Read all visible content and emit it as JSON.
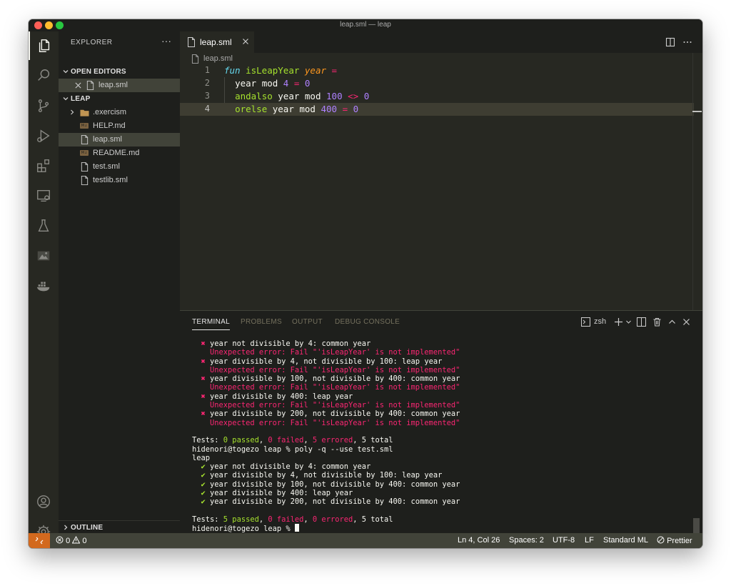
{
  "window": {
    "title": "leap.sml — leap"
  },
  "sidebar": {
    "title": "EXPLORER",
    "more": "···",
    "open_editors": {
      "label": "OPEN EDITORS",
      "items": [
        {
          "name": "leap.sml"
        }
      ]
    },
    "folder": {
      "label": "LEAP",
      "items": [
        {
          "name": ".exercism",
          "type": "folder"
        },
        {
          "name": "HELP.md",
          "type": "md",
          "badge": "M↓"
        },
        {
          "name": "leap.sml",
          "type": "file",
          "selected": true
        },
        {
          "name": "README.md",
          "type": "md",
          "badge": "M↓"
        },
        {
          "name": "test.sml",
          "type": "file"
        },
        {
          "name": "testlib.sml",
          "type": "file"
        }
      ]
    },
    "outline_label": "OUTLINE"
  },
  "editor": {
    "tab": "leap.sml",
    "breadcrumb": "leap.sml",
    "line_numbers": [
      "1",
      "2",
      "3",
      "4"
    ],
    "lines": {
      "l1": {
        "kw": "fun",
        "fn": "isLeapYear",
        "param": "year",
        "op": "="
      },
      "l2": {
        "a": "year mod ",
        "n1": "4",
        "b": " = ",
        "n2": "0"
      },
      "l3": {
        "kw": "andalso",
        "a": " year mod ",
        "n1": "100",
        "b": " <> ",
        "n2": "0"
      },
      "l4": {
        "kw": "orelse",
        "a": " year mod ",
        "n1": "400",
        "b": " = ",
        "n2": "0"
      }
    }
  },
  "panel": {
    "tabs": [
      "TERMINAL",
      "PROBLEMS",
      "OUTPUT",
      "DEBUG CONSOLE"
    ],
    "shell": "zsh",
    "terminal": {
      "failed_tests": [
        {
          "mark": "✖",
          "text": "year not divisible by 4: common year",
          "error": "Unexpected error: Fail \"'isLeapYear' is not implemented\""
        },
        {
          "mark": "✖",
          "text": "year divisible by 4, not divisible by 100: leap year",
          "error": "Unexpected error: Fail \"'isLeapYear' is not implemented\""
        },
        {
          "mark": "✖",
          "text": "year divisible by 100, not divisible by 400: common year",
          "error": "Unexpected error: Fail \"'isLeapYear' is not implemented\""
        },
        {
          "mark": "✖",
          "text": "year divisible by 400: leap year",
          "error": "Unexpected error: Fail \"'isLeapYear' is not implemented\""
        },
        {
          "mark": "✖",
          "text": "year divisible by 200, not divisible by 400: common year",
          "error": "Unexpected error: Fail \"'isLeapYear' is not implemented\""
        }
      ],
      "summary1": {
        "prefix": "Tests: ",
        "passed": "0 passed",
        "failed": "0 failed",
        "errored": "5 errored",
        "total": "5 total"
      },
      "prompt": "hidenori@togezo leap % ",
      "command": "poly -q --use test.sml",
      "suite": "leap",
      "passed_tests": [
        {
          "mark": "✔",
          "text": "year not divisible by 4: common year"
        },
        {
          "mark": "✔",
          "text": "year divisible by 4, not divisible by 100: leap year"
        },
        {
          "mark": "✔",
          "text": "year divisible by 100, not divisible by 400: common year"
        },
        {
          "mark": "✔",
          "text": "year divisible by 400: leap year"
        },
        {
          "mark": "✔",
          "text": "year divisible by 200, not divisible by 400: common year"
        }
      ],
      "summary2": {
        "prefix": "Tests: ",
        "passed": "5 passed",
        "failed": "0 failed",
        "errored": "0 errored",
        "total": "5 total"
      },
      "sep": ", "
    }
  },
  "status": {
    "errors": "0",
    "warnings": "0",
    "position": "Ln 4, Col 26",
    "spaces": "Spaces: 2",
    "encoding": "UTF-8",
    "eol": "LF",
    "language": "Standard ML",
    "prettier": "Prettier"
  },
  "colors": {
    "accent": "#d2691e",
    "statusbar": "#414339",
    "keyword": "#66d9ef",
    "function": "#a6e22e",
    "number": "#ae81ff",
    "error": "#f92672"
  }
}
